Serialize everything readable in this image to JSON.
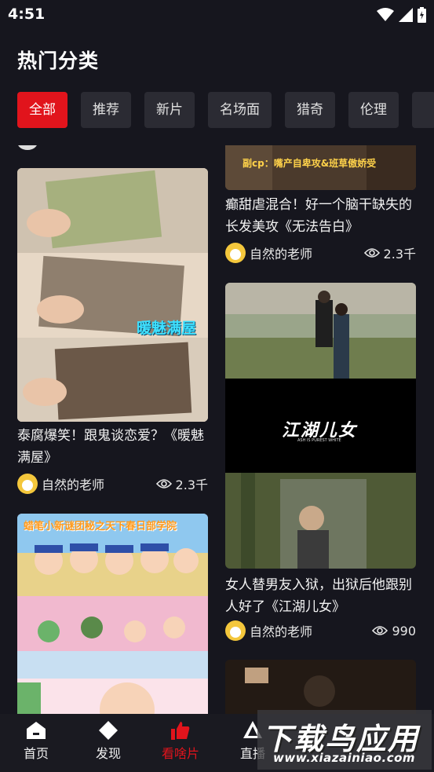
{
  "status": {
    "time": "4:51"
  },
  "header": {
    "title": "热门分类"
  },
  "tabs": [
    {
      "label": "全部",
      "active": true
    },
    {
      "label": "推荐"
    },
    {
      "label": "新片"
    },
    {
      "label": "名场面"
    },
    {
      "label": "猎奇"
    },
    {
      "label": "伦理"
    }
  ],
  "cards": {
    "left1": {
      "title": "泰腐爆笑！跟鬼谈恋爱？《暖魅满屋》",
      "overlay": "暖魅满屋",
      "author": "自然的老师",
      "views": "2.3千"
    },
    "left2": {
      "overlay": "蜡笔小新谜团秘之天下春日部学院"
    },
    "right1": {
      "overlay": "副cp：嘴产自卑攻&班草傲娇受",
      "title": "癫甜虐混合！好一个脑干缺失的长发美攻《无法告白》",
      "author": "自然的老师",
      "views": "2.3千"
    },
    "right2": {
      "overlay": "江湖儿女",
      "overlay_sub": "ASH IS PUREST WHITE",
      "title": "女人替男友入狱，出狱后他跟别人好了《江湖儿女》",
      "author": "自然的老师",
      "views": "990"
    }
  },
  "nav": [
    {
      "label": "首页",
      "icon": "home-icon"
    },
    {
      "label": "发现",
      "icon": "discover-icon"
    },
    {
      "label": "看啥片",
      "icon": "thumbs-up-icon",
      "active": true
    },
    {
      "label": "直播",
      "icon": "live-icon"
    }
  ],
  "watermark": {
    "big": "下载鸟应用",
    "small": "www.xiazainiao.com"
  },
  "colors": {
    "accent": "#e1141c",
    "background": "#16161e",
    "chip": "#2b2b33"
  }
}
